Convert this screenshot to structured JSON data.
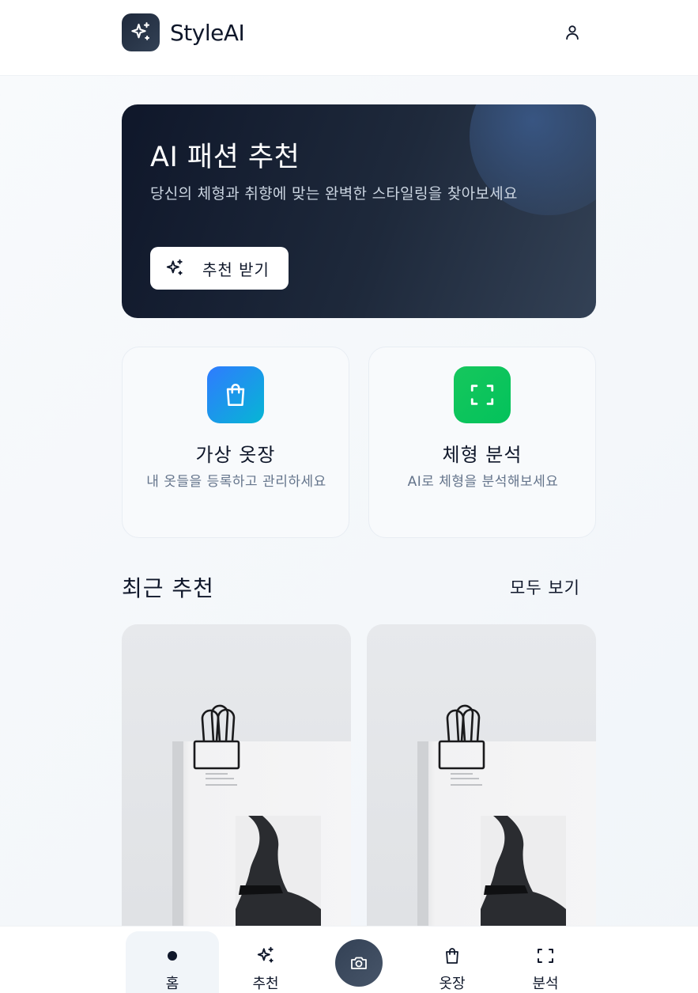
{
  "header": {
    "app_name": "StyleAI"
  },
  "hero": {
    "title": "AI 패션 추천",
    "subtitle": "당신의 체형과 취향에 맞는 완벽한 스타일링을 찾아보세요",
    "button_label": "추천 받기"
  },
  "features": [
    {
      "title": "가상 옷장",
      "desc": "내 옷들을 등록하고 관리하세요",
      "icon": "shopping-bag-icon"
    },
    {
      "title": "체형 분석",
      "desc": "AI로 체형을 분석해보세요",
      "icon": "scan-icon"
    }
  ],
  "recent": {
    "title": "최근 추천",
    "view_all": "모두 보기"
  },
  "nav": {
    "home": "홈",
    "recommend": "추천",
    "closet": "옷장",
    "analysis": "분석"
  }
}
